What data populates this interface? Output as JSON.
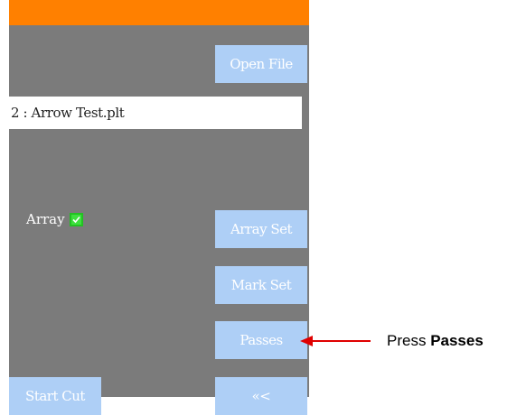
{
  "toolbar": {
    "open_file_label": "Open File",
    "array_set_label": "Array Set",
    "mark_set_label": "Mark Set",
    "passes_label": "Passes",
    "start_cut_label": "Start Cut",
    "back_label": "«<"
  },
  "file": {
    "value": "2 : Arrow Test.plt"
  },
  "array": {
    "label": "Array",
    "checked": true
  },
  "annotation": {
    "prefix": "Press ",
    "emphasis": "Passes"
  },
  "colors": {
    "panel_bg": "#7b7b7b",
    "top_bar": "#ff8000",
    "button_bg": "#aecff6",
    "checkbox": "#3ee03e",
    "arrow": "#e00000"
  }
}
